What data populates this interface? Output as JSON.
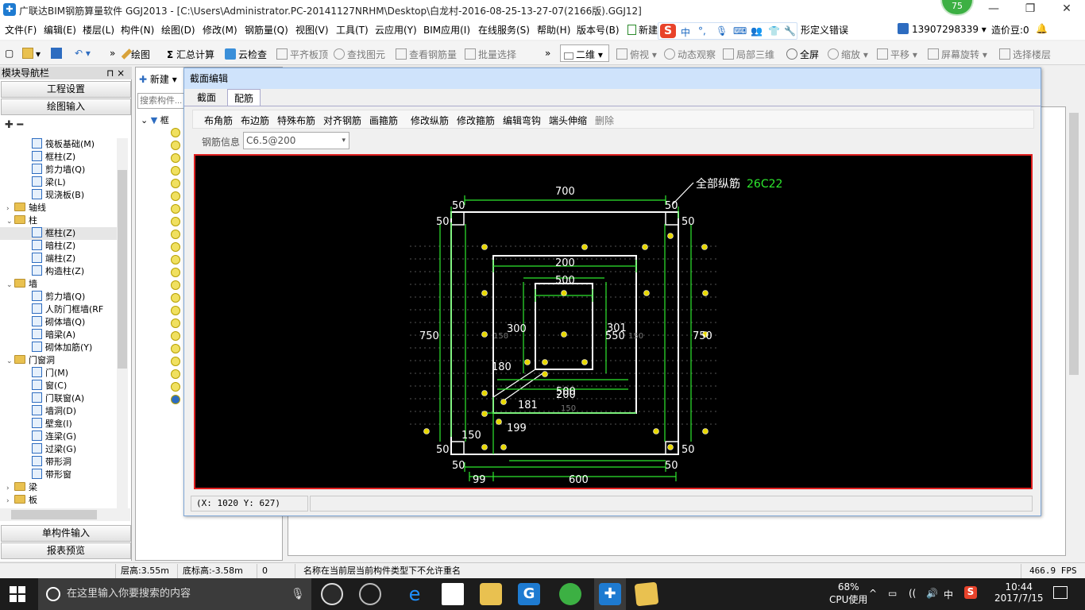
{
  "titlebar": {
    "title": "广联达BIM钢筋算量软件 GGJ2013 - [C:\\Users\\Administrator.PC-20141127NRHM\\Desktop\\白龙村-2016-08-25-13-27-07(2166版).GGJ12]",
    "badge": "75",
    "controls": [
      "—",
      "❐",
      "✕"
    ]
  },
  "menubar": {
    "items": [
      "文件(F)",
      "编辑(E)",
      "楼层(L)",
      "构件(N)",
      "绘图(D)",
      "修改(M)",
      "钢筋量(Q)",
      "视图(V)",
      "工具(T)",
      "云应用(Y)",
      "BIM应用(I)",
      "在线服务(S)",
      "帮助(H)",
      "版本号(B)",
      "新建",
      "形定义错误"
    ],
    "user": "13907298339",
    "price": "造价豆:0"
  },
  "ime": {
    "brand": "S",
    "items": [
      "中",
      "°,",
      "🎙",
      "⌨",
      "👥",
      "👕",
      "🔧"
    ]
  },
  "toolbar": {
    "items": [
      "绘图",
      "汇总计算",
      "云检查",
      "平齐板顶",
      "查找图元",
      "查看钢筋量",
      "批量选择",
      "二维",
      "俯视",
      "动态观察",
      "局部三维",
      "全屏",
      "缩放",
      "平移",
      "屏幕旋转",
      "选择楼层"
    ]
  },
  "leftpanel": {
    "title": "模块导航栏",
    "pin": "⊓ ×",
    "btn_settings": "工程设置",
    "btn_draw": "绘图输入",
    "btn_single": "单构件输入",
    "btn_report": "报表预览",
    "tree": [
      {
        "label": "筏板基础(M)",
        "indent": 2,
        "type": "item"
      },
      {
        "label": "框柱(Z)",
        "indent": 2,
        "type": "item"
      },
      {
        "label": "剪力墙(Q)",
        "indent": 2,
        "type": "item"
      },
      {
        "label": "梁(L)",
        "indent": 2,
        "type": "item"
      },
      {
        "label": "现浇板(B)",
        "indent": 2,
        "type": "item"
      },
      {
        "label": "轴线",
        "indent": 1,
        "type": "folder",
        "arrow": "›"
      },
      {
        "label": "柱",
        "indent": 1,
        "type": "folder",
        "arrow": "⌄"
      },
      {
        "label": "框柱(Z)",
        "indent": 2,
        "type": "item",
        "selected": true
      },
      {
        "label": "暗柱(Z)",
        "indent": 2,
        "type": "item"
      },
      {
        "label": "端柱(Z)",
        "indent": 2,
        "type": "item"
      },
      {
        "label": "构造柱(Z)",
        "indent": 2,
        "type": "item"
      },
      {
        "label": "墙",
        "indent": 1,
        "type": "folder",
        "arrow": "⌄"
      },
      {
        "label": "剪力墙(Q)",
        "indent": 2,
        "type": "item"
      },
      {
        "label": "人防门框墙(RF",
        "indent": 2,
        "type": "item"
      },
      {
        "label": "砌体墙(Q)",
        "indent": 2,
        "type": "item"
      },
      {
        "label": "暗梁(A)",
        "indent": 2,
        "type": "item"
      },
      {
        "label": "砌体加筋(Y)",
        "indent": 2,
        "type": "item"
      },
      {
        "label": "门窗洞",
        "indent": 1,
        "type": "folder",
        "arrow": "⌄"
      },
      {
        "label": "门(M)",
        "indent": 2,
        "type": "item"
      },
      {
        "label": "窗(C)",
        "indent": 2,
        "type": "item"
      },
      {
        "label": "门联窗(A)",
        "indent": 2,
        "type": "item"
      },
      {
        "label": "墙洞(D)",
        "indent": 2,
        "type": "item"
      },
      {
        "label": "壁龛(I)",
        "indent": 2,
        "type": "item"
      },
      {
        "label": "连梁(G)",
        "indent": 2,
        "type": "item"
      },
      {
        "label": "过梁(G)",
        "indent": 2,
        "type": "item"
      },
      {
        "label": "带形洞",
        "indent": 2,
        "type": "item"
      },
      {
        "label": "带形窗",
        "indent": 2,
        "type": "item"
      },
      {
        "label": "梁",
        "indent": 1,
        "type": "folder",
        "arrow": "›"
      },
      {
        "label": "板",
        "indent": 1,
        "type": "folder",
        "arrow": "›"
      }
    ]
  },
  "midpanel": {
    "new_btn": "新建",
    "search_placeholder": "搜索构件...",
    "root": "框"
  },
  "dialog": {
    "title": "截面编辑",
    "tabs": [
      "截面",
      "配筋"
    ],
    "tools": [
      "布角筋",
      "布边筋",
      "特殊布筋",
      "对齐钢筋",
      "画箍筋",
      "修改纵筋",
      "修改箍筋",
      "编辑弯钩",
      "端头伸缩",
      "删除"
    ],
    "rebar_label": "钢筋信息",
    "rebar_value": "C6.5@200",
    "coords": "(X: 1020 Y: 627)",
    "drawing": {
      "dims": [
        "700",
        "50",
        "50",
        "50",
        "50",
        "750",
        "750",
        "200",
        "500",
        "300",
        "301",
        "550",
        "180",
        "500",
        "200",
        "181",
        "199",
        "150",
        "50",
        "50",
        "50",
        "50",
        "99",
        "600",
        "150",
        "150",
        "150"
      ],
      "annotation_label": "全部纵筋",
      "annotation_value": "26C22"
    }
  },
  "statusbar": {
    "floor_height": "层高:3.55m",
    "bottom_height": "底标高:-3.58m",
    "zero": "0",
    "message": "名称在当前层当前构件类型下不允许重名",
    "fps": "466.9 FPS"
  },
  "taskbar": {
    "search_placeholder": "在这里输入你要搜索的内容",
    "cpu": "68%",
    "cpu_label": "CPU使用",
    "ime": "中",
    "time": "10:44",
    "date": "2017/7/15"
  }
}
